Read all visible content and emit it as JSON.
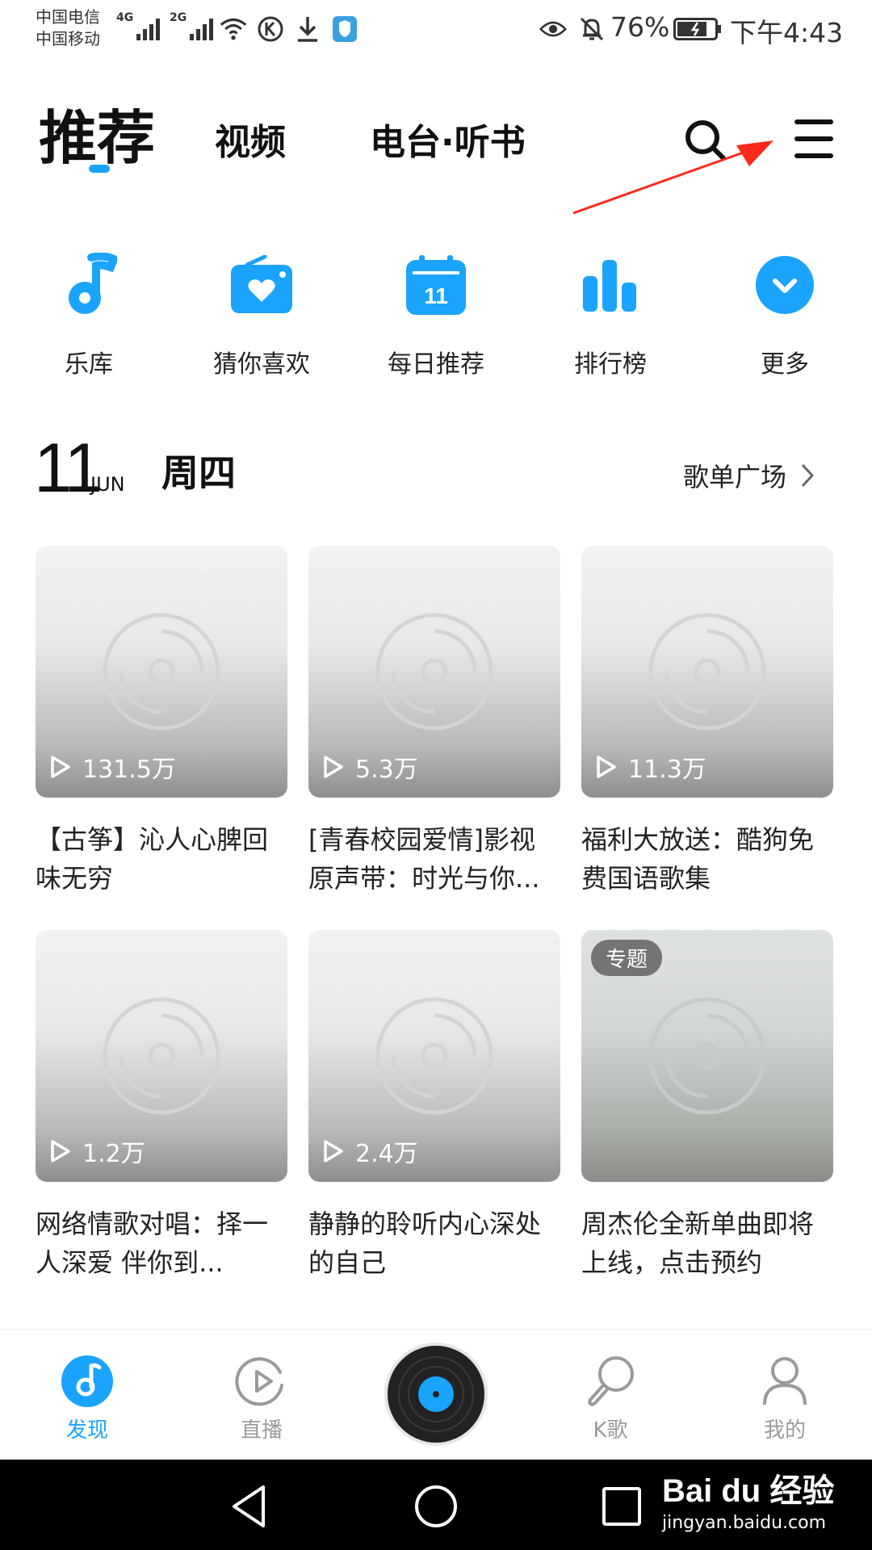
{
  "status_bar": {
    "carrier_1": "中国电信",
    "carrier_2": "中国移动",
    "net_1": "4G",
    "net_2": "2G",
    "battery": "76%",
    "time": "下午4:43"
  },
  "top_tabs": {
    "items": [
      "推荐",
      "视频",
      "电台·听书"
    ],
    "active_index": 0
  },
  "quick_nav": {
    "items": [
      {
        "label": "乐库",
        "icon": "music-note-icon"
      },
      {
        "label": "猜你喜欢",
        "icon": "radio-heart-icon"
      },
      {
        "label": "每日推荐",
        "icon": "calendar-icon",
        "badge": "11"
      },
      {
        "label": "排行榜",
        "icon": "bar-chart-icon"
      },
      {
        "label": "更多",
        "icon": "chevron-down-circle-icon"
      }
    ]
  },
  "date_header": {
    "day": "11",
    "month": "JUN",
    "weekday": "周四",
    "more_link": "歌单广场"
  },
  "playlists": [
    {
      "plays": "131.5万",
      "title": "【古筝】沁人心脾回味无穷"
    },
    {
      "plays": "5.3万",
      "title": "[青春校园爱情]影视原声带：时光与你..."
    },
    {
      "plays": "11.3万",
      "title": "福利大放送：酷狗免费国语歌集"
    },
    {
      "plays": "1.2万",
      "title": "网络情歌对唱：择一人深爱 伴你到..."
    },
    {
      "plays": "2.4万",
      "title": "静静的聆听内心深处的自己"
    },
    {
      "badge": "专题",
      "title": "周杰伦全新单曲即将上线，点击预约"
    }
  ],
  "bottom_nav": {
    "items": [
      {
        "label": "发现",
        "icon": "discover-icon",
        "active": true
      },
      {
        "label": "直播",
        "icon": "live-play-icon",
        "active": false
      },
      {
        "label": "",
        "icon": "vinyl-player-icon",
        "active": false
      },
      {
        "label": "K歌",
        "icon": "microphone-icon",
        "active": false
      },
      {
        "label": "我的",
        "icon": "user-icon",
        "active": false
      }
    ]
  },
  "watermark": {
    "logo": "Bai du 经验",
    "url": "jingyan.baidu.com"
  },
  "colors": {
    "accent": "#1aa3ff",
    "annotation_arrow": "#ff2a1a",
    "inactive": "#9a9a9a"
  }
}
